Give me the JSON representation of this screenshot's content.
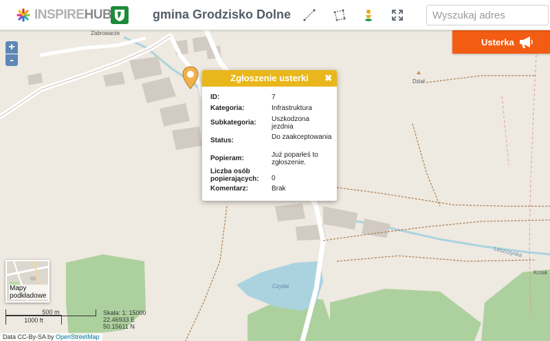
{
  "header": {
    "logo_text_a": "INSPIRE",
    "logo_text_b": "HUB",
    "title": "gmina Grodzisko Dolne",
    "tools": [
      "measure-line-icon",
      "measure-area-icon",
      "location-icon",
      "fullscreen-icon"
    ],
    "search_placeholder": "Wyszukaj adres"
  },
  "map": {
    "zoom_in": "+",
    "zoom_out": "-",
    "labels": {
      "zabrowarze": "Zabrowarze",
      "dzial": "Dział",
      "czyste": "Czyste",
      "leszczynka": "Leszczynka",
      "krzak": "Krzak"
    }
  },
  "usterka_button": {
    "label": "Usterka",
    "icon": "megaphone-icon"
  },
  "popup": {
    "title": "Zgłoszenie usterki",
    "close": "✖",
    "rows": [
      {
        "key": "ID:",
        "value": "7"
      },
      {
        "key": "Kategoria:",
        "value": "Infrastruktura"
      },
      {
        "key": "Subkategoria:",
        "value": "Uszkodzona jezdnia"
      },
      {
        "key": "Status:",
        "value": "Do zaakceptowania"
      },
      {
        "key": "Popieram:",
        "value": "Już poparłeś to zgłoszenie."
      },
      {
        "key": "Liczba osób popierających:",
        "value": "0"
      },
      {
        "key": "Komentarz:",
        "value": "Brak"
      }
    ]
  },
  "basemap": {
    "label": "Mapy podkładowe"
  },
  "scale": {
    "metric": "500 m",
    "imperial": "1000 ft",
    "scale_text": "Skala: 1: 15000",
    "lon": "22.46933 E",
    "lat": "50.15611 N"
  },
  "attribution": {
    "prefix": "Data CC-By-SA by",
    "link": "OpenStreetMap"
  },
  "colors": {
    "accent_orange": "#f25c13",
    "popup_header": "#e9b71b",
    "zoom_blue": "#5d87b6",
    "map_bg": "#eee9e1",
    "forest": "#add19e",
    "water": "#aad3df"
  }
}
